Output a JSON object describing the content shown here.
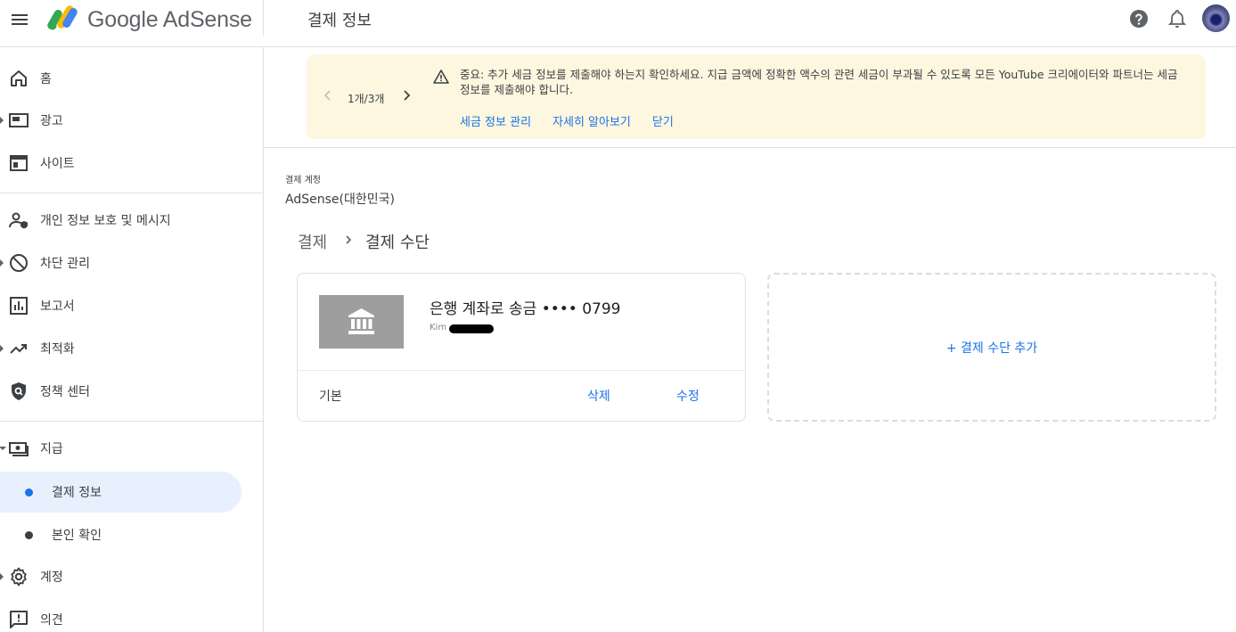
{
  "header": {
    "product_name": "Google AdSense",
    "page_title": "결제 정보",
    "icons": [
      "menu-icon",
      "help-icon",
      "notifications-icon",
      "avatar"
    ]
  },
  "sidebar": {
    "items": [
      {
        "label": "홈",
        "icon": "home-icon"
      },
      {
        "label": "광고",
        "icon": "ads-icon"
      },
      {
        "label": "사이트",
        "icon": "sites-icon"
      },
      {
        "label": "개인 정보 보호 및 메시지",
        "icon": "privacy-icon"
      },
      {
        "label": "차단 관리",
        "icon": "block-icon"
      },
      {
        "label": "보고서",
        "icon": "reports-icon"
      },
      {
        "label": "최적화",
        "icon": "optimize-icon"
      },
      {
        "label": "정책 센터",
        "icon": "policy-icon"
      },
      {
        "label": "지급",
        "icon": "payments-icon"
      },
      {
        "label": "계정",
        "icon": "settings-icon"
      },
      {
        "label": "의견",
        "icon": "feedback-icon"
      }
    ],
    "sub_items": [
      {
        "label": "결제 정보",
        "active": true
      },
      {
        "label": "본인 확인",
        "active": false
      }
    ]
  },
  "banner": {
    "counter": "1개/3개",
    "message": "중요: 추가 세금 정보를 제출해야 하는지 확인하세요. 지급 금액에 정확한 액수의 관련 세금이 부과될 수 있도록 모든 YouTube 크리에이터와 파트너는 세금 정보를 제출해야 합니다.",
    "links": {
      "manage_tax": "세금 정보 관리",
      "learn_more": "자세히 알아보기",
      "close": "닫기"
    }
  },
  "account": {
    "label": "결제 계정",
    "name": "AdSense(대한민국)"
  },
  "breadcrumb": {
    "parent": "결제",
    "current": "결제 수단"
  },
  "payment_method": {
    "title": "은행 계좌로 송금 •••• 0799",
    "holder": "Kim",
    "status": "기본",
    "delete_label": "삭제",
    "edit_label": "수정"
  },
  "add_payment_method": "+ 결제 수단 추가",
  "colors": {
    "accent": "#1a73e8",
    "banner_bg": "#fef7e0",
    "active_nav_bg": "#e8f0fe"
  }
}
